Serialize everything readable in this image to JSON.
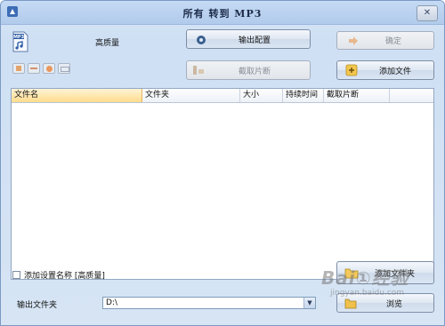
{
  "window": {
    "title": "所有 转到 MP3",
    "close_glyph": "✕"
  },
  "toolbar": {
    "format_icon_text": "MP3",
    "quality_label": "高质量",
    "output_config_label": "输出配置",
    "confirm_label": "确定",
    "clip_label": "截取片断",
    "add_file_label": "添加文件"
  },
  "file_list": {
    "columns": [
      "文件名",
      "文件夹",
      "大小",
      "持续时间",
      "截取片断"
    ],
    "rows": []
  },
  "options": {
    "add_setting_name_label": "添加设置名称 [高质量]",
    "add_setting_name_checked": false
  },
  "output": {
    "folder_label": "输出文件夹",
    "folder_value": "D:\\",
    "add_folder_label": "添加文件夹",
    "browse_label": "浏览"
  },
  "watermark": {
    "main": "Bai①经验",
    "sub": "jingyan.baidu.com"
  },
  "colors": {
    "accent_orange": "#ffcf6e",
    "title_bg": "#b1cbec"
  }
}
